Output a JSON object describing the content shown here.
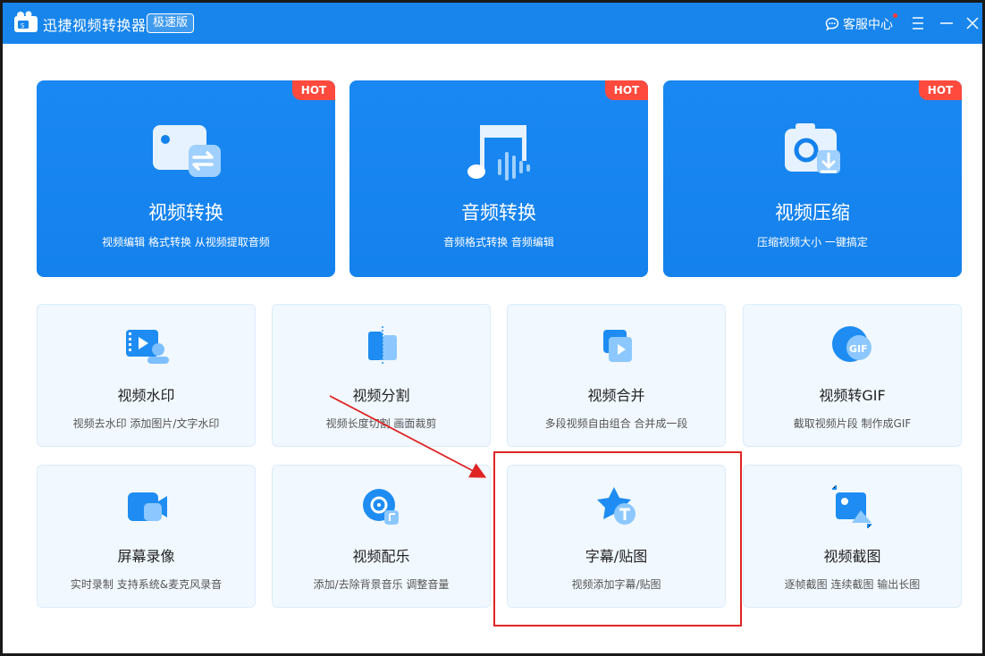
{
  "window": {
    "title": "迅捷视频转换器",
    "badge": "极速版",
    "service_label": "客服中心"
  },
  "colors": {
    "titlebar": "#1785ec",
    "card_primary": "#1481ec",
    "hot_badge": "#ff4a3d",
    "card_light": "#f1f8ff",
    "annotation": "#e02424"
  },
  "feature_cards": [
    {
      "title": "视频转换",
      "desc": "视频编辑 格式转换 从视频提取音频",
      "badge": "HOT",
      "icon": "video-convert-icon"
    },
    {
      "title": "音频转换",
      "desc": "音频格式转换 音频编辑",
      "badge": "HOT",
      "icon": "audio-convert-icon"
    },
    {
      "title": "视频压缩",
      "desc": "压缩视频大小 一键搞定",
      "badge": "HOT",
      "icon": "video-compress-icon"
    }
  ],
  "tools": [
    {
      "title": "视频水印",
      "desc": "视频去水印 添加图片/文字水印",
      "icon": "watermark-icon"
    },
    {
      "title": "视频分割",
      "desc": "视频长度切割 画面裁剪",
      "icon": "split-icon"
    },
    {
      "title": "视频合并",
      "desc": "多段视频自由组合 合并成一段",
      "icon": "merge-icon"
    },
    {
      "title": "视频转GIF",
      "desc": "截取视频片段 制作成GIF",
      "icon": "gif-icon"
    },
    {
      "title": "屏幕录像",
      "desc": "实时录制 支持系统&麦克风录音",
      "icon": "screen-record-icon"
    },
    {
      "title": "视频配乐",
      "desc": "添加/去除背景音乐 调整音量",
      "icon": "music-icon"
    },
    {
      "title": "字幕/贴图",
      "desc": "视频添加字幕/贴图",
      "icon": "subtitle-sticker-icon"
    },
    {
      "title": "视频截图",
      "desc": "逐帧截图 连续截图 输出长图",
      "icon": "screenshot-icon"
    }
  ]
}
